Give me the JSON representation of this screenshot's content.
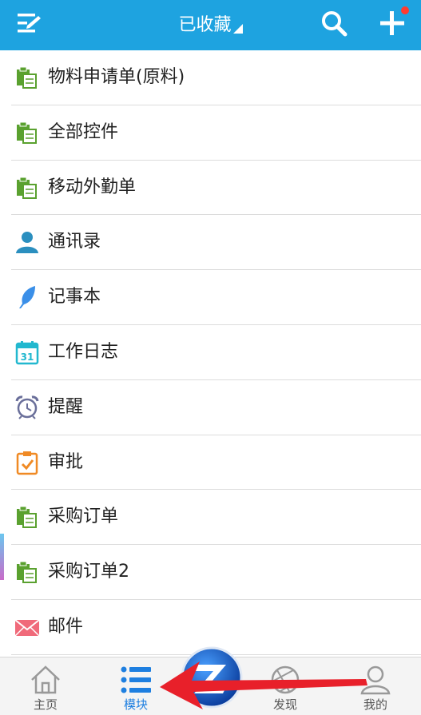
{
  "header": {
    "title": "已收藏",
    "menu_icon": "edit-menu-icon",
    "search_icon": "search-icon",
    "add_icon": "plus-icon",
    "notification_color": "#ff3b30",
    "bg_color": "#1ea3e0"
  },
  "list": {
    "items": [
      {
        "label": "物料申请单(原料)",
        "icon": "clipboard-form-icon"
      },
      {
        "label": "全部控件",
        "icon": "clipboard-form-icon"
      },
      {
        "label": "移动外勤单",
        "icon": "clipboard-form-icon"
      },
      {
        "label": "通讯录",
        "icon": "contact-person-icon"
      },
      {
        "label": "记事本",
        "icon": "feather-icon"
      },
      {
        "label": "工作日志",
        "icon": "calendar-icon"
      },
      {
        "label": "提醒",
        "icon": "alarm-clock-icon"
      },
      {
        "label": "审批",
        "icon": "approval-clipboard-icon"
      },
      {
        "label": "采购订单",
        "icon": "clipboard-form-icon"
      },
      {
        "label": "采购订单2",
        "icon": "clipboard-form-icon"
      },
      {
        "label": "邮件",
        "icon": "mail-icon"
      }
    ]
  },
  "tabbar": {
    "tabs": [
      {
        "label": "主页",
        "icon": "home-icon",
        "active": false
      },
      {
        "label": "模块",
        "icon": "list-icon",
        "active": true
      },
      {
        "label": "发现",
        "icon": "aperture-icon",
        "active": false
      },
      {
        "label": "我的",
        "icon": "profile-icon",
        "active": false
      }
    ],
    "center_logo": "z-logo-icon",
    "active_color": "#1e7fe0"
  },
  "annotation": {
    "arrow_color": "#e8202a"
  }
}
